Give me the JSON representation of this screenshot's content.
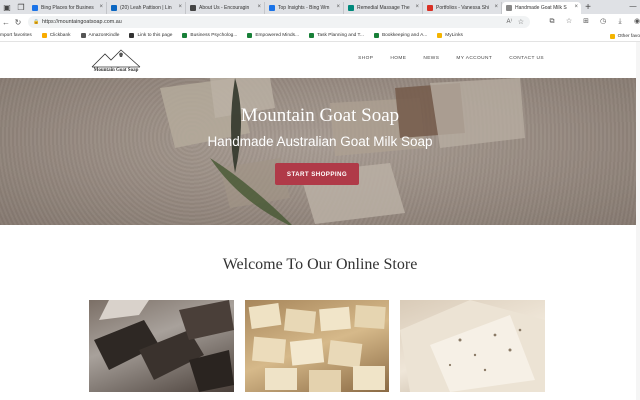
{
  "browser": {
    "tabs": [
      {
        "label": "Bing Places for Busines",
        "fav_color": "#1a73e8"
      },
      {
        "label": "(20) Leah Pattison | Lin",
        "fav_color": "#0a66c2"
      },
      {
        "label": "About Us - Encouragin",
        "fav_color": "#444444"
      },
      {
        "label": "Top Insights - Bing Wm",
        "fav_color": "#1a73e8"
      },
      {
        "label": "Remedial Massage The",
        "fav_color": "#00897b"
      },
      {
        "label": "Portfolios - Vanessa Shi",
        "fav_color": "#d93025"
      },
      {
        "label": "Handmade Goat Milk S",
        "fav_color": "#888888",
        "active": true
      }
    ],
    "url": "https://mountaingoatsoap.com.au",
    "favorites": [
      {
        "label": "mport favorites",
        "color": ""
      },
      {
        "label": "Clickbank",
        "color": "#f9ab00"
      },
      {
        "label": "AmazonKindle",
        "color": "#555555"
      },
      {
        "label": "Link to this page",
        "color": "#333333"
      },
      {
        "label": "Business Psycholog...",
        "color": "#188038"
      },
      {
        "label": "Empowered Minds...",
        "color": "#188038"
      },
      {
        "label": "Task Planning and T...",
        "color": "#188038"
      },
      {
        "label": "Bookkeeping and A...",
        "color": "#188038"
      },
      {
        "label": "MyLinks",
        "color": "#f4b400"
      }
    ],
    "other_favorites": "Other favo"
  },
  "site": {
    "logo_text": "Mountain Goat Soap",
    "nav": [
      "SHOP",
      "HOME",
      "NEWS",
      "MY ACCOUNT",
      "CONTACT US"
    ],
    "hero": {
      "title": "Mountain Goat Soap",
      "subtitle": "Handmade Australian Goat Milk Soap",
      "cta": "START SHOPPING"
    },
    "welcome": "Welcome To Our Online Store"
  },
  "colors": {
    "cta": "#b03a48",
    "tabstrip": "#dfe1e5"
  },
  "icons": [
    "window-icon",
    "tabs-icon",
    "back-arrow-icon",
    "refresh-icon",
    "lock-icon",
    "read-aloud-icon",
    "star-icon",
    "extensions-icon",
    "favorites-icon",
    "collections-icon",
    "history-icon",
    "downloads-icon",
    "profile-icon",
    "folder-icon"
  ]
}
